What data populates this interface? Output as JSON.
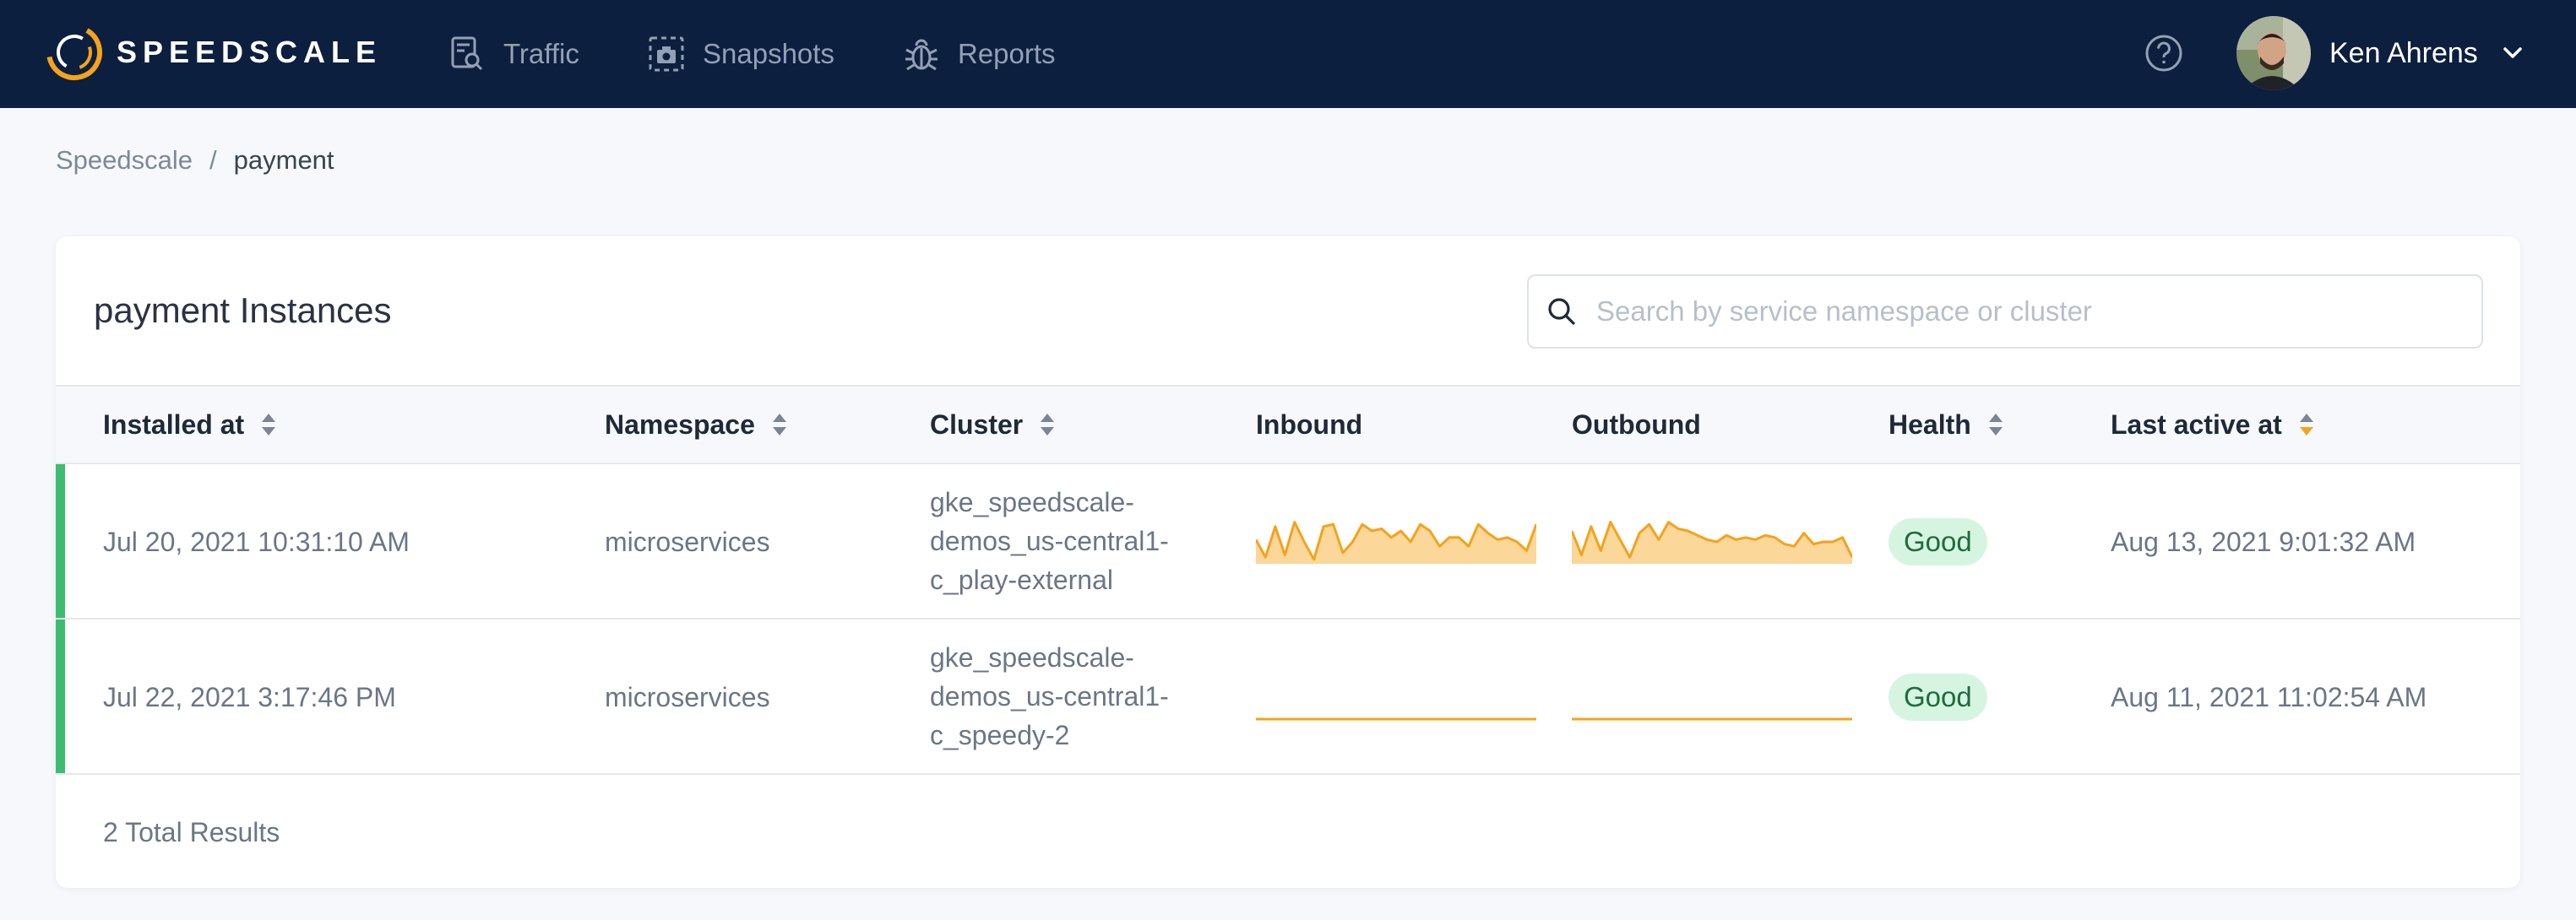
{
  "nav": {
    "brand": "SPEEDSCALE",
    "links": [
      {
        "label": "Traffic",
        "icon": "traffic-icon"
      },
      {
        "label": "Snapshots",
        "icon": "snapshot-camera-icon"
      },
      {
        "label": "Reports",
        "icon": "bug-icon"
      }
    ],
    "user_name": "Ken Ahrens"
  },
  "breadcrumb": {
    "root": "Speedscale",
    "separator": "/",
    "current": "payment"
  },
  "card": {
    "title": "payment Instances",
    "search_placeholder": "Search by service namespace or cluster"
  },
  "table": {
    "columns": [
      {
        "label": "Installed at",
        "sortable": true
      },
      {
        "label": "Namespace",
        "sortable": true
      },
      {
        "label": "Cluster",
        "sortable": true
      },
      {
        "label": "Inbound",
        "sortable": false
      },
      {
        "label": "Outbound",
        "sortable": false
      },
      {
        "label": "Health",
        "sortable": true
      },
      {
        "label": "Last active at",
        "sortable": true,
        "active_sort": true
      }
    ],
    "rows": [
      {
        "installed_at": "Jul 20, 2021 10:31:10 AM",
        "namespace": "microservices",
        "cluster_lines": [
          "gke_speedscale-",
          "demos_us-central1-",
          "c_play-external"
        ],
        "inbound": [
          0.55,
          0.15,
          0.85,
          0.2,
          0.95,
          0.5,
          0.1,
          0.85,
          0.9,
          0.25,
          0.5,
          0.9,
          0.75,
          0.8,
          0.6,
          0.75,
          0.5,
          0.9,
          0.75,
          0.4,
          0.6,
          0.6,
          0.4,
          0.9,
          0.7,
          0.55,
          0.6,
          0.5,
          0.3,
          0.9
        ],
        "outbound": [
          0.75,
          0.2,
          0.85,
          0.3,
          0.95,
          0.55,
          0.15,
          0.7,
          0.9,
          0.55,
          0.95,
          0.8,
          0.75,
          0.65,
          0.55,
          0.5,
          0.65,
          0.55,
          0.6,
          0.55,
          0.65,
          0.6,
          0.45,
          0.4,
          0.7,
          0.45,
          0.5,
          0.5,
          0.6,
          0.15
        ],
        "health": "Good",
        "last_active": "Aug 13, 2021 9:01:32 AM"
      },
      {
        "installed_at": "Jul 22, 2021 3:17:46 PM",
        "namespace": "microservices",
        "cluster_lines": [
          "gke_speedscale-",
          "demos_us-central1-",
          "c_speedy-2"
        ],
        "inbound": [
          0,
          0,
          0,
          0,
          0,
          0,
          0,
          0,
          0,
          0
        ],
        "outbound": [
          0,
          0,
          0,
          0,
          0,
          0,
          0,
          0,
          0,
          0
        ],
        "health": "Good",
        "last_active": "Aug 11, 2021 11:02:54 AM"
      }
    ]
  },
  "footer": {
    "total": "2 Total Results"
  },
  "colors": {
    "nav_bg": "#0c1f3f",
    "health_accent": "#3dbd70",
    "spark_line": "#f4a31c",
    "spark_fill": "#fcd79a",
    "sort_active": "#f4a31c"
  }
}
